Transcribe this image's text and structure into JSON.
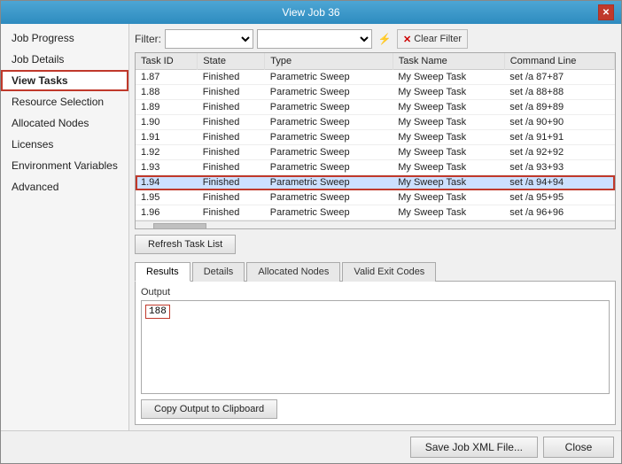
{
  "window": {
    "title": "View Job 36",
    "close_label": "✕"
  },
  "sidebar": {
    "items": [
      {
        "id": "job-progress",
        "label": "Job Progress"
      },
      {
        "id": "job-details",
        "label": "Job Details"
      },
      {
        "id": "view-tasks",
        "label": "View Tasks",
        "active": true
      },
      {
        "id": "resource-selection",
        "label": "Resource Selection"
      },
      {
        "id": "allocated-nodes",
        "label": "Allocated Nodes"
      },
      {
        "id": "licenses",
        "label": "Licenses"
      },
      {
        "id": "environment-variables",
        "label": "Environment Variables"
      },
      {
        "id": "advanced",
        "label": "Advanced"
      }
    ]
  },
  "filter": {
    "label": "Filter:",
    "clear_label": "Clear Filter"
  },
  "table": {
    "columns": [
      "Task ID",
      "State",
      "Type",
      "Task Name",
      "Command Line"
    ],
    "rows": [
      {
        "id": "1.87",
        "state": "Finished",
        "type": "Parametric Sweep",
        "name": "My Sweep Task",
        "cmd": "set /a 87+87"
      },
      {
        "id": "1.88",
        "state": "Finished",
        "type": "Parametric Sweep",
        "name": "My Sweep Task",
        "cmd": "set /a 88+88"
      },
      {
        "id": "1.89",
        "state": "Finished",
        "type": "Parametric Sweep",
        "name": "My Sweep Task",
        "cmd": "set /a 89+89"
      },
      {
        "id": "1.90",
        "state": "Finished",
        "type": "Parametric Sweep",
        "name": "My Sweep Task",
        "cmd": "set /a 90+90"
      },
      {
        "id": "1.91",
        "state": "Finished",
        "type": "Parametric Sweep",
        "name": "My Sweep Task",
        "cmd": "set /a 91+91"
      },
      {
        "id": "1.92",
        "state": "Finished",
        "type": "Parametric Sweep",
        "name": "My Sweep Task",
        "cmd": "set /a 92+92"
      },
      {
        "id": "1.93",
        "state": "Finished",
        "type": "Parametric Sweep",
        "name": "My Sweep Task",
        "cmd": "set /a 93+93"
      },
      {
        "id": "1.94",
        "state": "Finished",
        "type": "Parametric Sweep",
        "name": "My Sweep Task",
        "cmd": "set /a 94+94",
        "selected": true
      },
      {
        "id": "1.95",
        "state": "Finished",
        "type": "Parametric Sweep",
        "name": "My Sweep Task",
        "cmd": "set /a 95+95"
      },
      {
        "id": "1.96",
        "state": "Finished",
        "type": "Parametric Sweep",
        "name": "My Sweep Task",
        "cmd": "set /a 96+96"
      }
    ]
  },
  "refresh_btn": "Refresh Task List",
  "tabs": {
    "items": [
      {
        "id": "results",
        "label": "Results",
        "active": true
      },
      {
        "id": "details",
        "label": "Details"
      },
      {
        "id": "allocated-nodes",
        "label": "Allocated Nodes"
      },
      {
        "id": "valid-exit-codes",
        "label": "Valid Exit Codes"
      }
    ]
  },
  "results": {
    "output_label": "Output",
    "output_value": "188"
  },
  "copy_btn": "Copy Output to Clipboard",
  "bottom": {
    "save_btn": "Save Job XML File...",
    "close_btn": "Close"
  }
}
